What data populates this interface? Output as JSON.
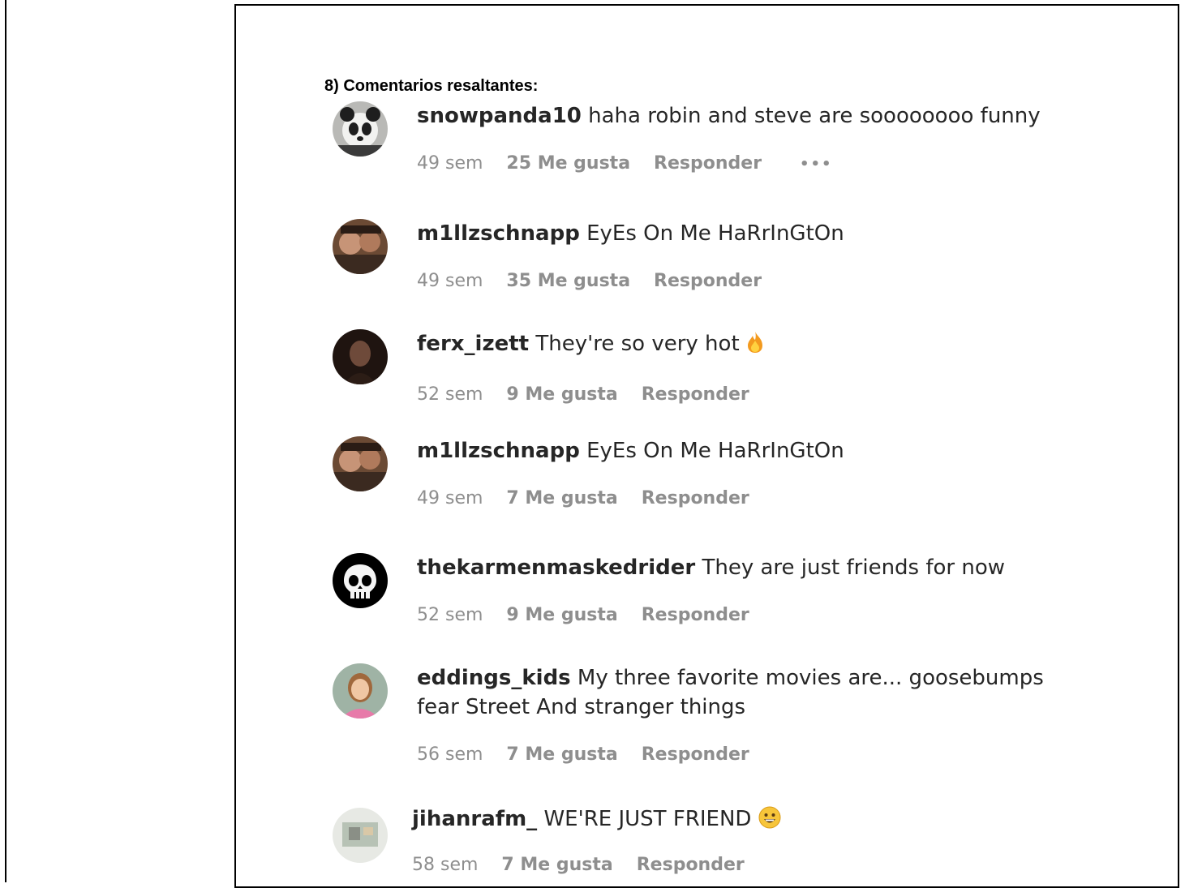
{
  "section_title": "8) Comentarios resaltantes:",
  "comments": [
    {
      "user": "snowpanda10",
      "text": "haha robin and steve are soooooooo funny",
      "time": "49 sem",
      "likes": "25 Me gusta",
      "reply": "Responder",
      "more": "•••",
      "avatar": "panda-avatar-icon"
    },
    {
      "user": "m1llzschnapp",
      "text": "EyEs On Me HaRrInGtOn",
      "time": "49 sem",
      "likes": "35 Me gusta",
      "reply": "Responder",
      "avatar": "couple-photo-avatar-icon"
    },
    {
      "user": "ferx_izett",
      "text": "They're so very hot",
      "emoji": "fire-emoji-icon",
      "time": "52 sem",
      "likes": "9 Me gusta",
      "reply": "Responder",
      "avatar": "dark-portrait-avatar-icon"
    },
    {
      "user": "m1llzschnapp",
      "text": "EyEs On Me HaRrInGtOn",
      "time": "49 sem",
      "likes": "7 Me gusta",
      "reply": "Responder",
      "avatar": "couple-photo-avatar-icon"
    },
    {
      "user": "thekarmenmaskedrider",
      "text": "They are just friends for now",
      "time": "52 sem",
      "likes": "9 Me gusta",
      "reply": "Responder",
      "avatar": "skull-avatar-icon"
    },
    {
      "user": "eddings_kids",
      "text": "My three favorite movies are... goosebumps fear Street And stranger things",
      "time": "56 sem",
      "likes": "7 Me gusta",
      "reply": "Responder",
      "avatar": "child-portrait-avatar-icon"
    },
    {
      "user": "jihanrafm_",
      "text": "WE'RE JUST FRIEND",
      "emoji": "grinning-face-emoji-icon",
      "time": "58 sem",
      "likes": "7 Me gusta",
      "reply": "Responder",
      "avatar": "light-photo-avatar-icon"
    }
  ]
}
